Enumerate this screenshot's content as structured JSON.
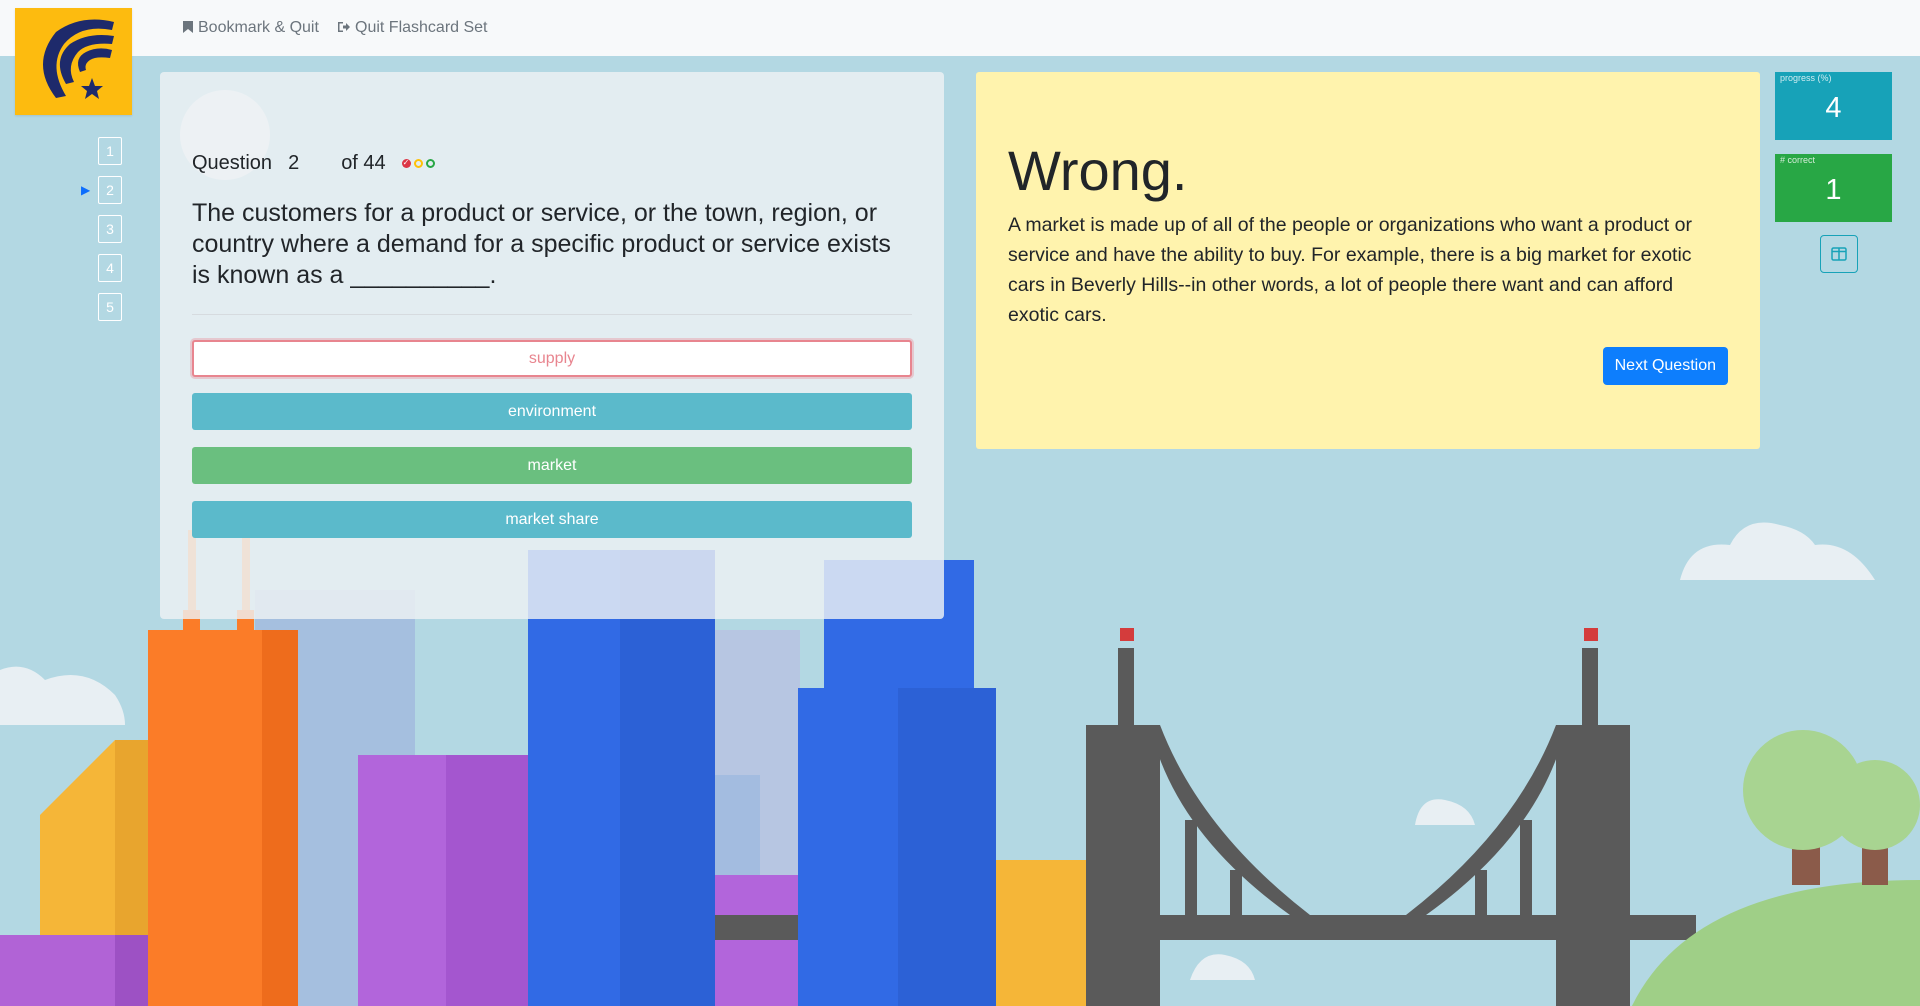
{
  "top_nav": {
    "bookmark_label": "Bookmark & Quit",
    "quit_label": "Quit Flashcard Set"
  },
  "question_nav": {
    "items": [
      "1",
      "2",
      "3",
      "4",
      "5"
    ],
    "current_index": 2
  },
  "question": {
    "label": "Question",
    "number": "2",
    "of_total": "of 44",
    "text": "The customers for a product or service, or the town, region, or country where a demand for a specific product or service exists is known as a __________.",
    "indicators": [
      "wrong-mark-icon",
      "yellow-circle-icon",
      "green-circle-icon"
    ]
  },
  "answers": [
    {
      "label": "supply",
      "state": "wrong"
    },
    {
      "label": "environment",
      "state": "neutral"
    },
    {
      "label": "market",
      "state": "correct"
    },
    {
      "label": "market share",
      "state": "neutral"
    }
  ],
  "feedback": {
    "title": "Wrong.",
    "text": "A market is made up of all of the people or organizations who want a product or service and have the ability to buy. For example, there is a big market for exotic cars in Beverly Hills--in other words, a lot of people there want and can afford exotic cars.",
    "next_label": "Next Question"
  },
  "stats": {
    "progress_label": "progress (%)",
    "progress_value": "4",
    "correct_label": "# correct",
    "correct_value": "1"
  },
  "colors": {
    "logo": "#fdbb0f",
    "feedback_bg": "#fff3ad",
    "accent_teal": "#17a2b8",
    "accent_green": "#28a745",
    "primary": "#0d7efd"
  }
}
